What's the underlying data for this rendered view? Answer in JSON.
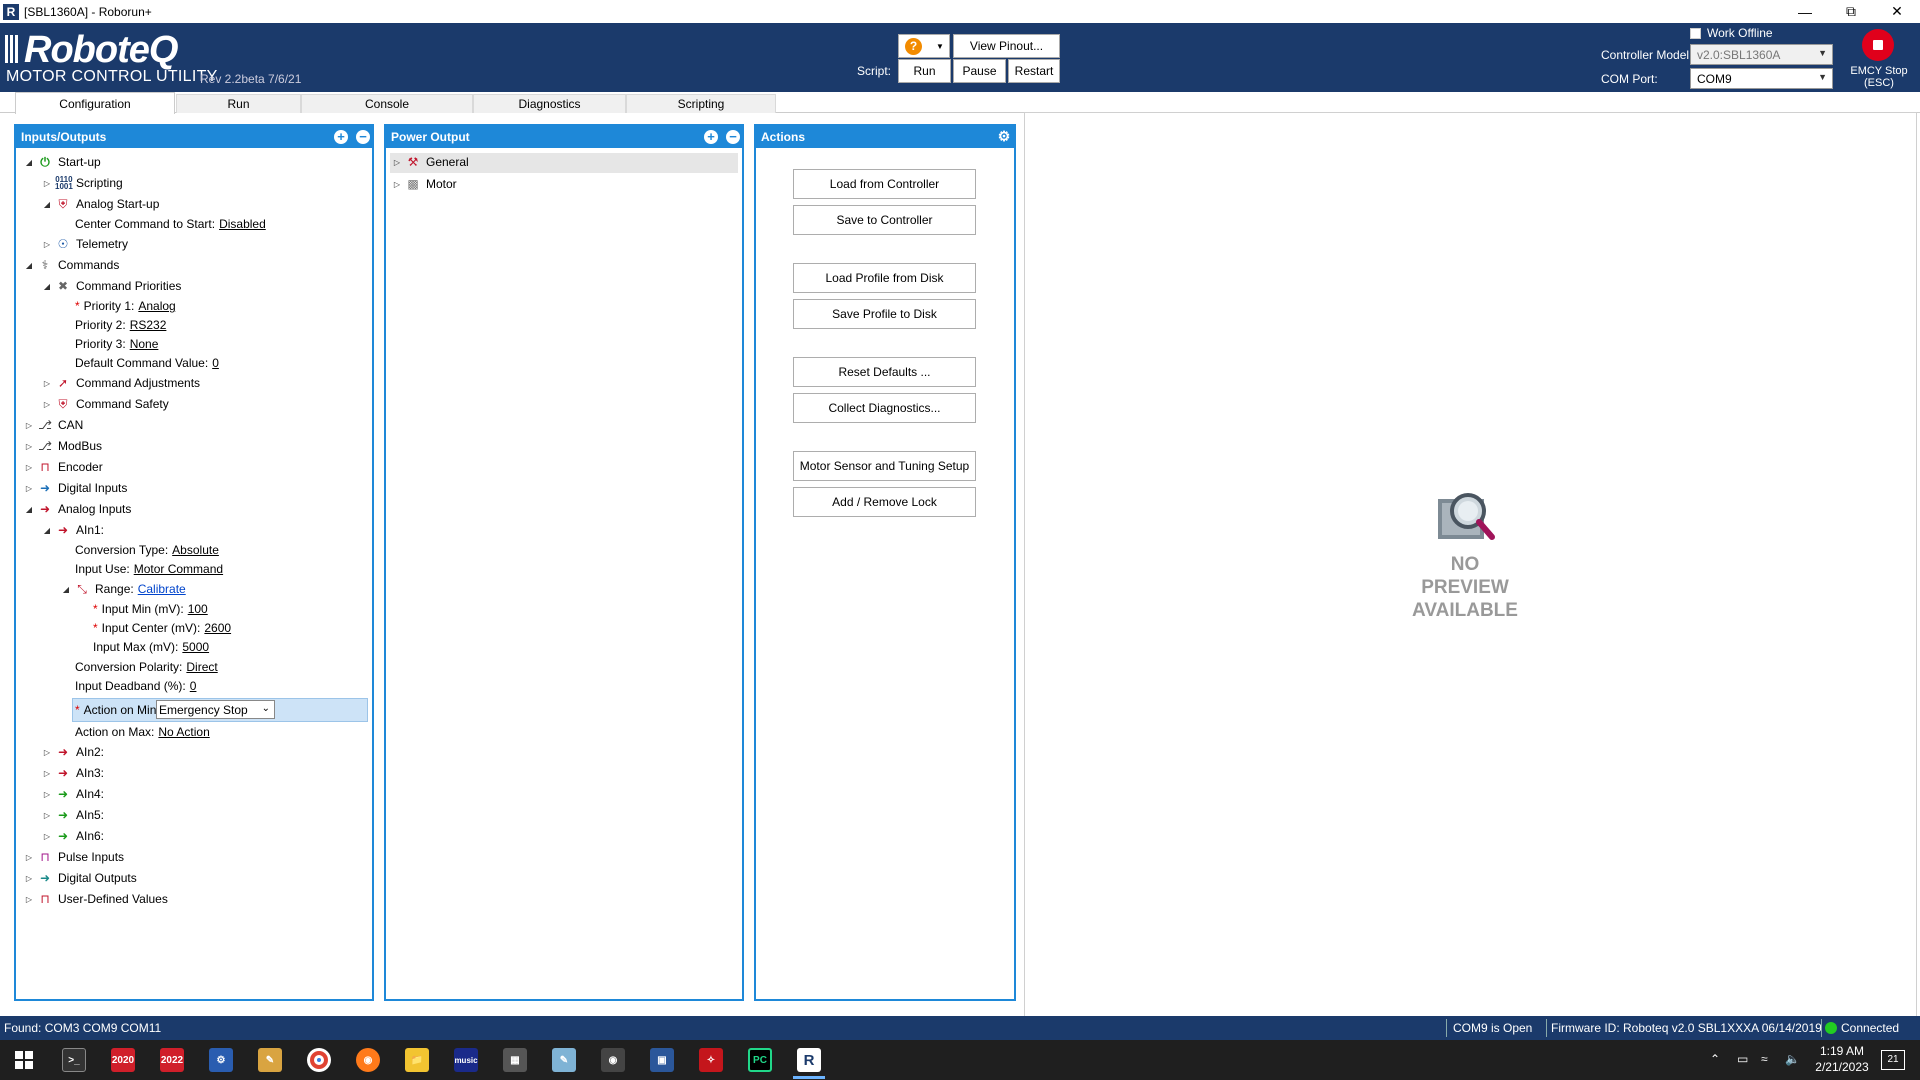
{
  "window": {
    "title": "[SBL1360A] - Roborun+",
    "icon": "roborun-app-icon"
  },
  "header": {
    "logo": "RoboteQ",
    "product": "MOTOR CONTROL UTILITY",
    "revision": "Rev 2.2beta 7/6/21",
    "view_pinout": "View Pinout...",
    "script_label": "Script:",
    "run": "Run",
    "pause": "Pause",
    "restart": "Restart",
    "work_offline": "Work Offline",
    "controller_model_label": "Controller Model:",
    "controller_model_value": "v2.0:SBL1360A",
    "com_port_label": "COM Port:",
    "com_port_value": "COM9",
    "emcy_label_1": "EMCY Stop",
    "emcy_label_2": "(ESC)"
  },
  "tabs": [
    "Configuration",
    "Run",
    "Console",
    "Diagnostics",
    "Scripting"
  ],
  "io_panel": {
    "title": "Inputs/Outputs",
    "rows": [
      {
        "label": "Start-up",
        "value": ""
      },
      {
        "label": "Scripting",
        "value": ""
      },
      {
        "label": "Analog Start-up",
        "value": ""
      },
      {
        "label": "Center Command to Start:",
        "value": "Disabled"
      },
      {
        "label": "Telemetry",
        "value": ""
      },
      {
        "label": "Commands",
        "value": ""
      },
      {
        "label": "Command Priorities",
        "value": ""
      },
      {
        "label": "Priority 1:",
        "value": "Analog"
      },
      {
        "label": "Priority 2:",
        "value": "RS232"
      },
      {
        "label": "Priority 3:",
        "value": "None"
      },
      {
        "label": "Default Command Value:",
        "value": "0"
      },
      {
        "label": "Command Adjustments",
        "value": ""
      },
      {
        "label": "Command Safety",
        "value": ""
      },
      {
        "label": "CAN",
        "value": ""
      },
      {
        "label": "ModBus",
        "value": ""
      },
      {
        "label": "Encoder",
        "value": ""
      },
      {
        "label": "Digital Inputs",
        "value": ""
      },
      {
        "label": "Analog Inputs",
        "value": ""
      },
      {
        "label": "AIn1:",
        "value": ""
      },
      {
        "label": "Conversion Type:",
        "value": "Absolute"
      },
      {
        "label": "Input Use:",
        "value": "Motor Command"
      },
      {
        "label": "Range:",
        "value": "Calibrate"
      },
      {
        "label": "Input Min (mV):",
        "value": "100"
      },
      {
        "label": "Input Center (mV):",
        "value": "2600"
      },
      {
        "label": "Input Max (mV):",
        "value": "5000"
      },
      {
        "label": "Conversion Polarity:",
        "value": "Direct"
      },
      {
        "label": "Input Deadband (%):",
        "value": "0"
      },
      {
        "label": "Action on Min:",
        "value": "Emergency Stop"
      },
      {
        "label": "Action on Max:",
        "value": "No Action"
      },
      {
        "label": "AIn2:",
        "value": ""
      },
      {
        "label": "AIn3:",
        "value": ""
      },
      {
        "label": "AIn4:",
        "value": ""
      },
      {
        "label": "AIn5:",
        "value": ""
      },
      {
        "label": "AIn6:",
        "value": ""
      },
      {
        "label": "Pulse Inputs",
        "value": ""
      },
      {
        "label": "Digital Outputs",
        "value": ""
      },
      {
        "label": "User-Defined Values",
        "value": ""
      }
    ]
  },
  "power_panel": {
    "title": "Power Output",
    "rows": [
      "General",
      "Motor"
    ]
  },
  "actions_panel": {
    "title": "Actions",
    "buttons": [
      "Load from Controller",
      "Save to Controller",
      "Load Profile from Disk",
      "Save Profile to Disk",
      "Reset Defaults ...",
      "Collect Diagnostics...",
      "Motor Sensor and Tuning Setup",
      "Add / Remove Lock"
    ]
  },
  "preview": {
    "line1": "NO",
    "line2": "PREVIEW",
    "line3": "AVAILABLE"
  },
  "status": {
    "found": "Found: COM3 COM9 COM11",
    "port": "COM9 is Open",
    "firmware": "Firmware ID: Roboteq v2.0 SBL1XXXA 06/14/2019",
    "connected": "Connected",
    "connected_color": "#22cc22"
  },
  "taskbar": {
    "time": "1:19 AM",
    "date": "2/21/2023",
    "notifications": "21",
    "icons": [
      "windows-start-icon",
      "terminal-icon",
      "solidworks-2020-icon",
      "solidworks-2022-icon",
      "app-icon",
      "paint-icon",
      "chrome-icon",
      "firefox-icon",
      "file-explorer-icon",
      "amazon-music-icon",
      "calculator-icon",
      "notes-icon",
      "camera-icon",
      "window-app-icon",
      "acrobat-icon",
      "pycharm-icon",
      "roborun-icon"
    ],
    "sw2020": "2020",
    "sw2022": "2022",
    "amazon": "music",
    "pc": "PC"
  }
}
